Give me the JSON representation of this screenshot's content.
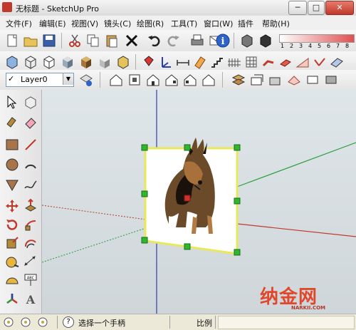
{
  "window": {
    "title": "无标题 - SketchUp Pro",
    "min": "─",
    "max": "□",
    "close": "✕"
  },
  "menu": [
    "文件(F)",
    "编辑(E)",
    "视图(V)",
    "镜头(C)",
    "绘图(R)",
    "工具(T)",
    "窗口(W)",
    "插件",
    "帮助(H)"
  ],
  "layer": {
    "check": "✓",
    "name": "Layer0",
    "dropdown": "▼"
  },
  "shadow_scale": [
    "1",
    "2",
    "3",
    "4",
    "5",
    "6",
    "7",
    "8"
  ],
  "status": {
    "hint": "选择一个手柄",
    "measure_label": "比例",
    "help_icon": "?"
  },
  "watermark": {
    "brand": "纳金网",
    "url": "NARKII.COM"
  },
  "colors": {
    "selection": "#2fb52f",
    "frame": "#e8e85a",
    "axis_red": "#c0392b",
    "axis_green": "#2e9e3e",
    "axis_blue": "#2b3fa8"
  }
}
